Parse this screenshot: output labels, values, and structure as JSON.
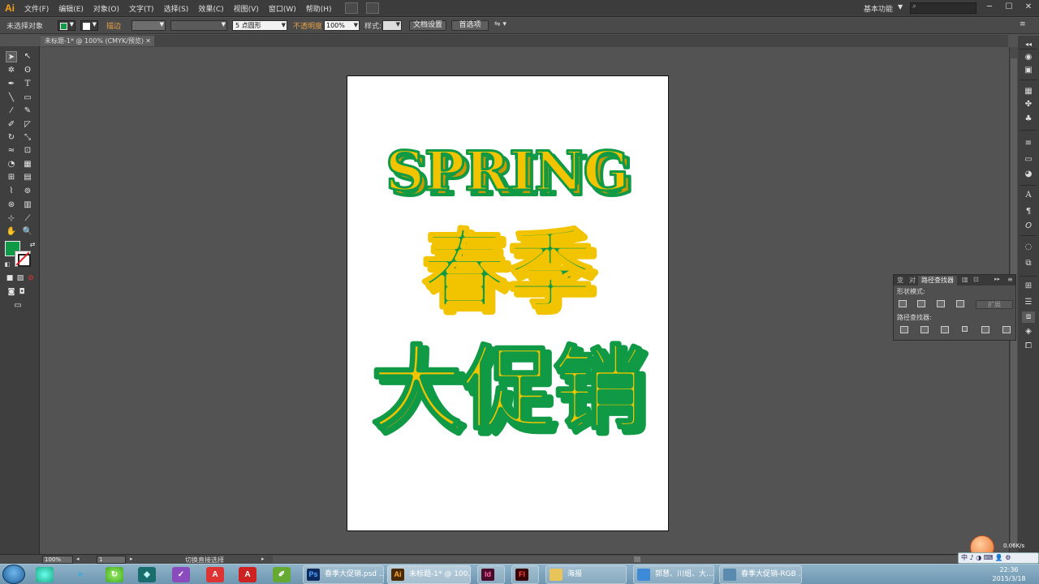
{
  "app": {
    "logo": "Ai"
  },
  "menu": [
    "文件(F)",
    "编辑(E)",
    "对象(O)",
    "文字(T)",
    "选择(S)",
    "效果(C)",
    "视图(V)",
    "窗口(W)",
    "帮助(H)"
  ],
  "workspace": {
    "label": "基本功能",
    "arrow": "▼"
  },
  "window_controls": {
    "minimize": "─",
    "maximize": "☐",
    "close": "✕"
  },
  "control": {
    "selection": "未选择对象",
    "stroke_label": "描边",
    "brush_size": "5 点圆形",
    "opacity_label": "不透明度",
    "opacity_value": "100%",
    "style_label": "样式:",
    "doc_setup": "文档设置",
    "preferences": "首选项",
    "fill_color": "#0f9a47"
  },
  "document_tab": {
    "title": "未标题-1* @ 100% (CMYK/预览)",
    "close": "✕"
  },
  "artwork": {
    "headline_en": "SPRING",
    "headline_cn_1": "春季",
    "headline_cn_2": "大促销",
    "colors": {
      "yellow": "#f2c400",
      "green": "#119a45",
      "shadow_yellow": "#c99a00",
      "shadow_green": "#0a6e30"
    }
  },
  "pathfinder": {
    "tabs": [
      "变",
      "对",
      "路径查找器"
    ],
    "shape_modes_label": "形状模式:",
    "pathfinders_label": "路径查找器:",
    "expand_label": "扩展",
    "menu_icon": "≡",
    "collapse_icon": "▸▸"
  },
  "status": {
    "zoom": "100%",
    "page": "1",
    "tool_hint": "切换直接选择"
  },
  "taskbar": {
    "windows": [
      {
        "icon": "Ps",
        "label": "春季大促销.psd ..."
      },
      {
        "icon": "Ai",
        "label": "未标题-1* @ 100..."
      },
      {
        "icon": "Id",
        "label": ""
      },
      {
        "icon": "Fl",
        "label": ""
      },
      {
        "icon": "📁",
        "label": "海报"
      },
      {
        "icon": "💬",
        "label": "郭慧、川组、大..."
      },
      {
        "icon": "🖼",
        "label": "春季大促销-RGB ..."
      }
    ],
    "clock_time": "22:36",
    "clock_date": "2015/3/18",
    "net_speed": "0.06K/s",
    "ime": "中 ♪ ◑ ⌨ 👤 ⚙"
  }
}
